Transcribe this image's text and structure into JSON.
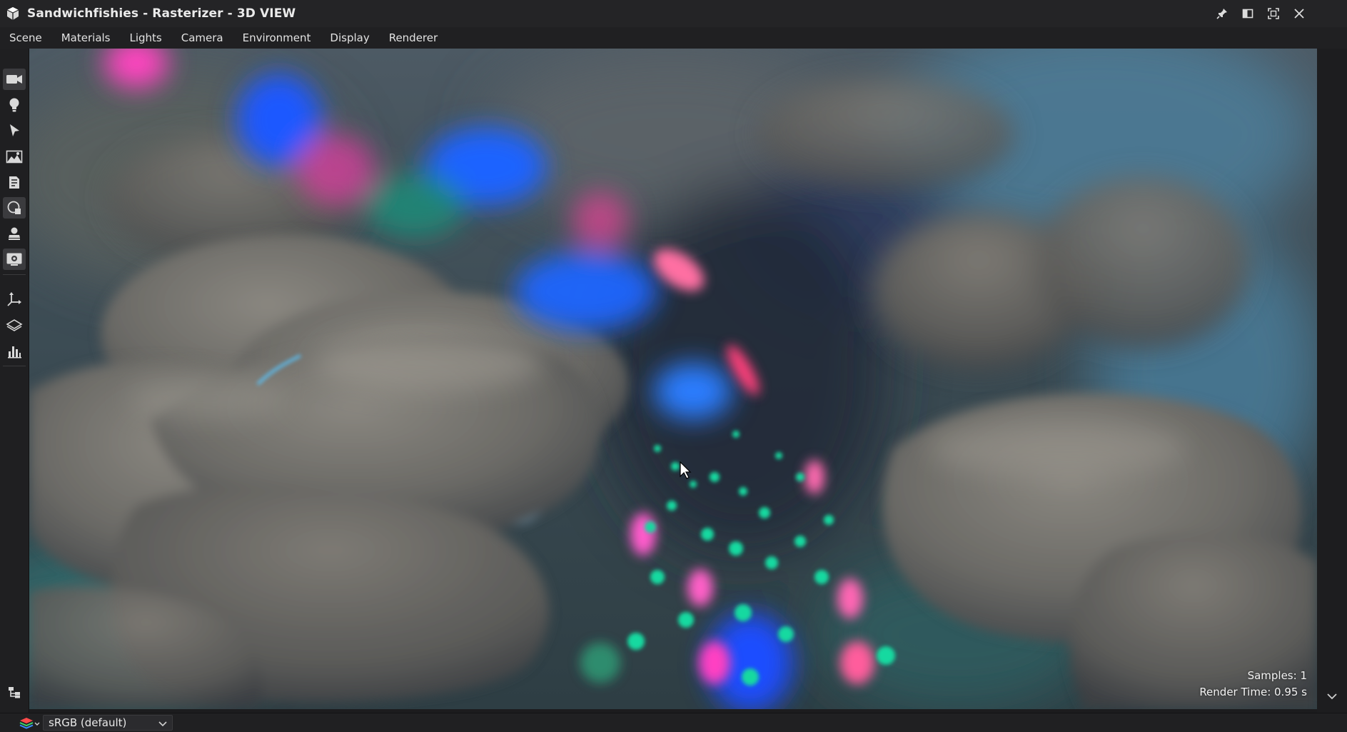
{
  "window": {
    "title": "Sandwichfishies - Rasterizer - 3D VIEW",
    "app_icon": "cube-icon",
    "controls": [
      "pin-icon",
      "restore-icon",
      "maximize-icon",
      "close-icon"
    ]
  },
  "menu": {
    "items": [
      {
        "label": "Scene"
      },
      {
        "label": "Materials"
      },
      {
        "label": "Lights"
      },
      {
        "label": "Camera"
      },
      {
        "label": "Environment"
      },
      {
        "label": "Display"
      },
      {
        "label": "Renderer"
      }
    ]
  },
  "toolbar": {
    "tools": [
      {
        "icon": "camera-icon",
        "active": true
      },
      {
        "icon": "light-bulb-icon",
        "active": false
      },
      {
        "icon": "select-arrow-icon",
        "active": false
      },
      {
        "icon": "environment-image-icon",
        "active": false
      },
      {
        "icon": "clipboard-icon",
        "active": false
      },
      {
        "icon": "material-sphere-icon",
        "active": true
      },
      {
        "icon": "stamp-icon",
        "active": false
      },
      {
        "icon": "render-settings-icon",
        "active": true
      },
      {
        "icon": "transform-axes-icon",
        "active": false
      },
      {
        "icon": "layers-plane-icon",
        "active": false
      },
      {
        "icon": "histogram-icon",
        "active": false
      }
    ],
    "bottom_tool": "hierarchy-icon"
  },
  "viewport": {
    "render_info": {
      "samples": "Samples: 1",
      "render_time": "Render Time: 0.95 s"
    }
  },
  "bottom_bar": {
    "colorspace": "sRGB (default)"
  },
  "colors": {
    "titlebar": "#242426",
    "menubar": "#202022",
    "accent_blue": "#1f6bff",
    "accent_pink": "#ff4fc0",
    "accent_green": "#19d9a0"
  }
}
